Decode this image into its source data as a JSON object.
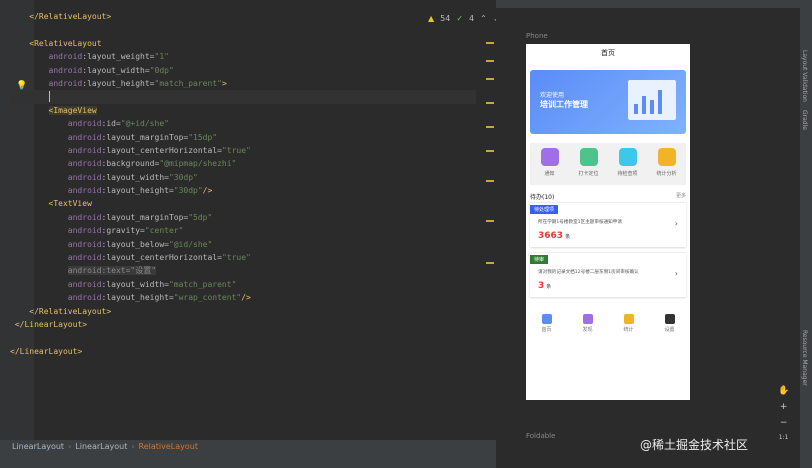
{
  "inspections": {
    "warnings": "54",
    "ok": "4"
  },
  "code_lines": [
    [
      {
        "t": "    ",
        "c": "pun"
      },
      {
        "t": "</RelativeLayout>",
        "c": "tag"
      }
    ],
    [
      {
        "t": "",
        "c": "pun"
      }
    ],
    [
      {
        "t": "    ",
        "c": "pun"
      },
      {
        "t": "<RelativeLayout",
        "c": "tag"
      }
    ],
    [
      {
        "t": "        ",
        "c": "pun"
      },
      {
        "t": "android",
        "c": "attr"
      },
      {
        "t": ":layout_weight=",
        "c": "an"
      },
      {
        "t": "\"1\"",
        "c": "val"
      }
    ],
    [
      {
        "t": "        ",
        "c": "pun"
      },
      {
        "t": "android",
        "c": "attr"
      },
      {
        "t": ":layout_width=",
        "c": "an"
      },
      {
        "t": "\"0dp\"",
        "c": "val"
      }
    ],
    [
      {
        "t": "        ",
        "c": "pun"
      },
      {
        "t": "android",
        "c": "attr"
      },
      {
        "t": ":layout_height=",
        "c": "an"
      },
      {
        "t": "\"match_parent\"",
        "c": "val"
      },
      {
        "t": ">",
        "c": "tag"
      }
    ],
    [
      {
        "t": "        ",
        "c": "pun"
      },
      {
        "t": "",
        "c": "caret"
      }
    ],
    [
      {
        "t": "        ",
        "c": "pun"
      },
      {
        "t": "<ImageView",
        "c": "tag hl-word"
      }
    ],
    [
      {
        "t": "            ",
        "c": "pun"
      },
      {
        "t": "android",
        "c": "attr"
      },
      {
        "t": ":id=",
        "c": "an"
      },
      {
        "t": "\"@+id/she\"",
        "c": "val"
      }
    ],
    [
      {
        "t": "            ",
        "c": "pun"
      },
      {
        "t": "android",
        "c": "attr"
      },
      {
        "t": ":layout_marginTop=",
        "c": "an"
      },
      {
        "t": "\"15dp\"",
        "c": "val"
      }
    ],
    [
      {
        "t": "            ",
        "c": "pun"
      },
      {
        "t": "android",
        "c": "attr"
      },
      {
        "t": ":layout_centerHorizontal=",
        "c": "an"
      },
      {
        "t": "\"true\"",
        "c": "val"
      }
    ],
    [
      {
        "t": "            ",
        "c": "pun"
      },
      {
        "t": "android",
        "c": "attr"
      },
      {
        "t": ":background=",
        "c": "an"
      },
      {
        "t": "\"@mipmap/shezhi\"",
        "c": "val"
      }
    ],
    [
      {
        "t": "            ",
        "c": "pun"
      },
      {
        "t": "android",
        "c": "attr"
      },
      {
        "t": ":layout_width=",
        "c": "an"
      },
      {
        "t": "\"30dp\"",
        "c": "val"
      }
    ],
    [
      {
        "t": "            ",
        "c": "pun"
      },
      {
        "t": "android",
        "c": "attr"
      },
      {
        "t": ":layout_height=",
        "c": "an"
      },
      {
        "t": "\"30dp\"",
        "c": "val"
      },
      {
        "t": "/>",
        "c": "tag"
      }
    ],
    [
      {
        "t": "        ",
        "c": "pun"
      },
      {
        "t": "<TextView",
        "c": "tag"
      }
    ],
    [
      {
        "t": "            ",
        "c": "pun"
      },
      {
        "t": "android",
        "c": "attr"
      },
      {
        "t": ":layout_marginTop=",
        "c": "an"
      },
      {
        "t": "\"5dp\"",
        "c": "val"
      }
    ],
    [
      {
        "t": "            ",
        "c": "pun"
      },
      {
        "t": "android",
        "c": "attr"
      },
      {
        "t": ":gravity=",
        "c": "an"
      },
      {
        "t": "\"center\"",
        "c": "val"
      }
    ],
    [
      {
        "t": "            ",
        "c": "pun"
      },
      {
        "t": "android",
        "c": "attr"
      },
      {
        "t": ":layout_below=",
        "c": "an"
      },
      {
        "t": "\"@id/she\"",
        "c": "val"
      }
    ],
    [
      {
        "t": "            ",
        "c": "pun"
      },
      {
        "t": "android",
        "c": "attr"
      },
      {
        "t": ":layout_centerHorizontal=",
        "c": "an"
      },
      {
        "t": "\"true\"",
        "c": "val"
      }
    ],
    [
      {
        "t": "            ",
        "c": "pun"
      },
      {
        "t": "android:text=",
        "c": "hl-line"
      },
      {
        "t": "\"设置\"",
        "c": "val hl-line"
      }
    ],
    [
      {
        "t": "            ",
        "c": "pun"
      },
      {
        "t": "android",
        "c": "attr"
      },
      {
        "t": ":layout_width=",
        "c": "an"
      },
      {
        "t": "\"match_parent\"",
        "c": "val"
      }
    ],
    [
      {
        "t": "            ",
        "c": "pun"
      },
      {
        "t": "android",
        "c": "attr"
      },
      {
        "t": ":layout_height=",
        "c": "an"
      },
      {
        "t": "\"wrap_content\"",
        "c": "val"
      },
      {
        "t": "/>",
        "c": "tag"
      }
    ],
    [
      {
        "t": "    ",
        "c": "pun"
      },
      {
        "t": "</RelativeLayout>",
        "c": "tag"
      }
    ],
    [
      {
        "t": " ",
        "c": "pun"
      },
      {
        "t": "</LinearLayout>",
        "c": "tag"
      }
    ],
    [
      {
        "t": "",
        "c": "pun"
      }
    ],
    [
      {
        "t": "",
        "c": "pun"
      },
      {
        "t": "</LinearLayout>",
        "c": "tag"
      }
    ]
  ],
  "breadcrumb": [
    "LinearLayout",
    "LinearLayout",
    "RelativeLayout"
  ],
  "design": {
    "device_label": "Phone",
    "foldable_label": "Foldable"
  },
  "app": {
    "title": "首页",
    "banner_line1": "欢迎使用",
    "banner_line2": "培训工作管理",
    "grid": [
      {
        "label": "通知",
        "color": "#a06ee6"
      },
      {
        "label": "打卡定位",
        "color": "#4ec48c"
      },
      {
        "label": "待检查项",
        "color": "#3ec8e8"
      },
      {
        "label": "统计分析",
        "color": "#f0b429"
      }
    ],
    "todo_title": "待办(10)",
    "todo_more": "更多",
    "cards": [
      {
        "badge": "待处理项",
        "badge_color": "#3d5afe",
        "desc": "所在学期1号楼教室1区主题审核通知申请",
        "count": "3663",
        "unit": "条"
      },
      {
        "badge": "待审",
        "badge_color": "#2e7d32",
        "desc": "请对我的记录文档12号楼二层东侧1房间审核确认",
        "count": "3",
        "unit": "条"
      }
    ],
    "nav": [
      {
        "label": "首页",
        "color": "#5b8cf7"
      },
      {
        "label": "发现",
        "color": "#a06ee6"
      },
      {
        "label": "统计",
        "color": "#f0b429"
      },
      {
        "label": "设置",
        "color": "#333333"
      }
    ]
  },
  "right_tabs": [
    "Layout Validation",
    "Gradle",
    "Resource Manager"
  ],
  "zoom": {
    "plus": "+",
    "minus": "−",
    "ratio": "1:1"
  },
  "watermark": "@稀土掘金技术社区"
}
